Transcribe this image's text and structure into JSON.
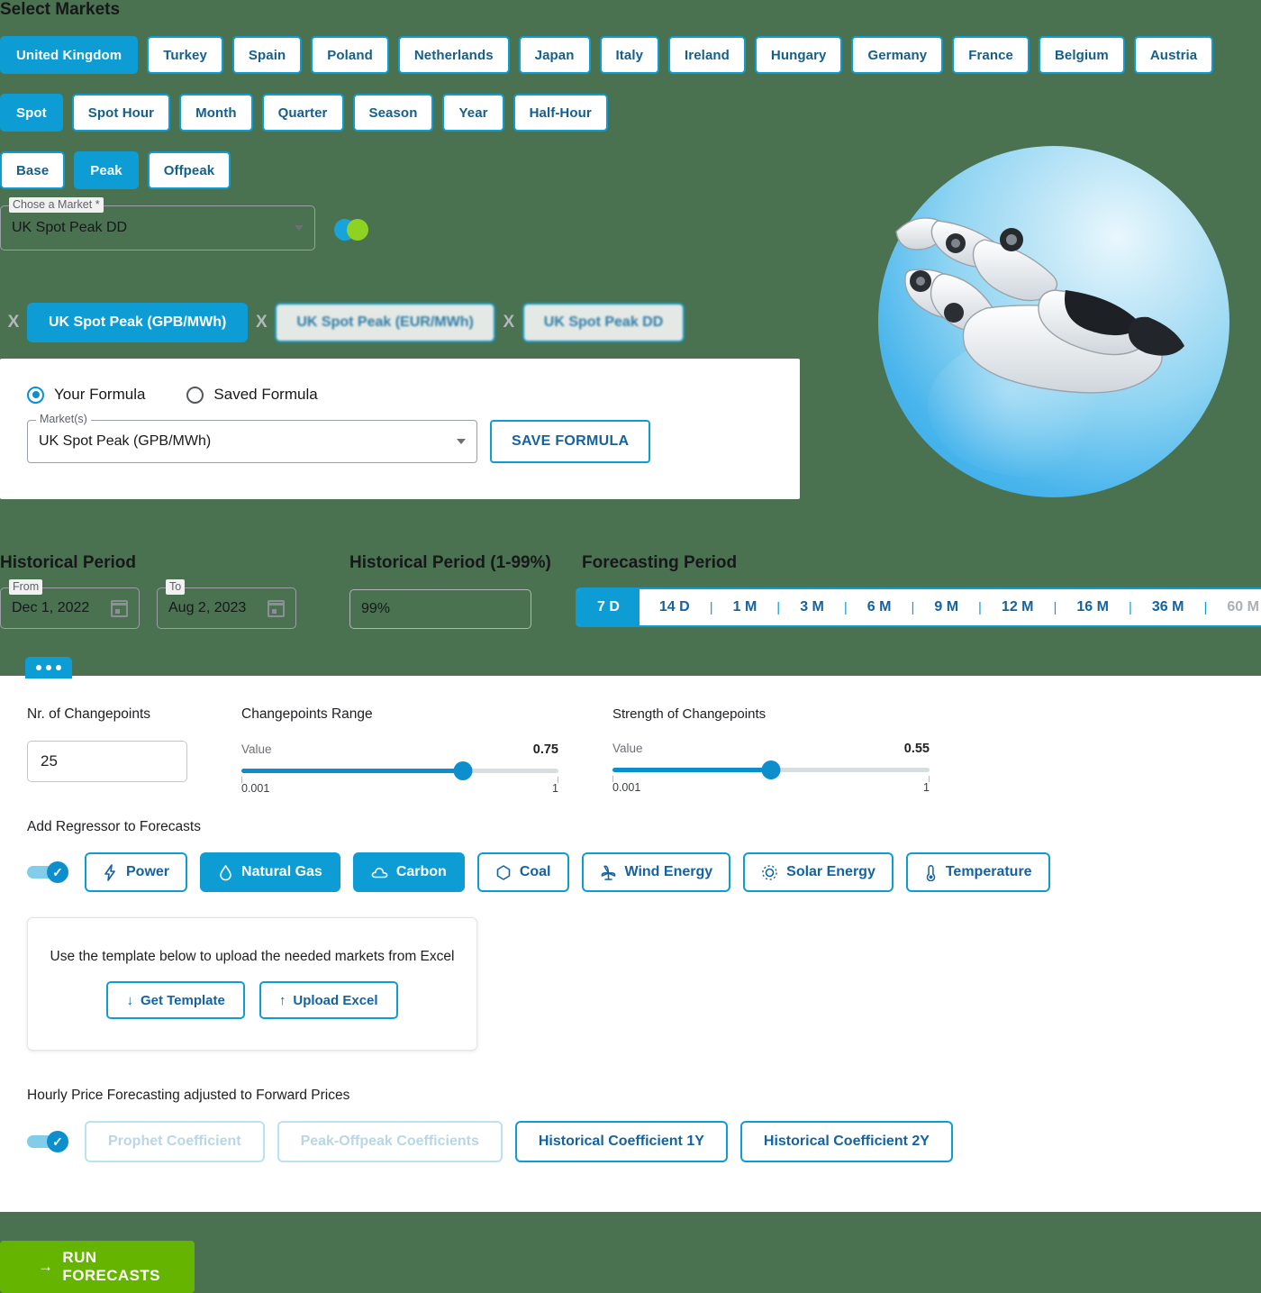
{
  "colors": {
    "accent": "#0d9dd4",
    "accent_dark": "#1463a0",
    "green_bg": "#4a7150",
    "run_green": "#64b400",
    "venn_blue": "#19a3db",
    "venn_green": "#8ed222"
  },
  "markets": {
    "title": "Select Markets",
    "countries": [
      {
        "label": "United Kingdom",
        "active": true
      },
      {
        "label": "Turkey",
        "active": false
      },
      {
        "label": "Spain",
        "active": false
      },
      {
        "label": "Poland",
        "active": false
      },
      {
        "label": "Netherlands",
        "active": false
      },
      {
        "label": "Japan",
        "active": false
      },
      {
        "label": "Italy",
        "active": false
      },
      {
        "label": "Ireland",
        "active": false
      },
      {
        "label": "Hungary",
        "active": false
      },
      {
        "label": "Germany",
        "active": false
      },
      {
        "label": "France",
        "active": false
      },
      {
        "label": "Belgium",
        "active": false
      },
      {
        "label": "Austria",
        "active": false
      }
    ],
    "granularities": [
      {
        "label": "Spot",
        "active": true
      },
      {
        "label": "Spot Hour",
        "active": false
      },
      {
        "label": "Month",
        "active": false
      },
      {
        "label": "Quarter",
        "active": false
      },
      {
        "label": "Season",
        "active": false
      },
      {
        "label": "Year",
        "active": false
      },
      {
        "label": "Half-Hour",
        "active": false
      }
    ],
    "loadshapes": [
      {
        "label": "Base",
        "active": false
      },
      {
        "label": "Peak",
        "active": true
      },
      {
        "label": "Offpeak",
        "active": false
      }
    ],
    "chose_market": {
      "label": "Chose a Market *",
      "value": "UK Spot Peak DD"
    },
    "chips": [
      {
        "label": "UK Spot Peak (GPB/MWh)",
        "active": true,
        "blurred": false,
        "remove": "X"
      },
      {
        "label": "UK Spot Peak (EUR/MWh)",
        "active": false,
        "blurred": true,
        "remove": "X"
      },
      {
        "label": "UK Spot Peak DD",
        "active": false,
        "blurred": true,
        "remove": "X"
      }
    ]
  },
  "formula": {
    "your_formula": "Your Formula",
    "saved_formula": "Saved Formula",
    "markets_label": "Market(s)",
    "markets_value": "UK Spot Peak (GPB/MWh)",
    "save_button": "SAVE FORMULA"
  },
  "periods": {
    "historical_title": "Historical Period",
    "from_label": "From",
    "from_value": "Dec 1, 2022",
    "to_label": "To",
    "to_value": "Aug 2, 2023",
    "percent_title": "Historical Period (1-99%)",
    "percent_value": "99%",
    "forecasting_title": "Forecasting Period",
    "forecast_options": [
      {
        "label": "7 D",
        "active": true,
        "disabled": false
      },
      {
        "label": "14 D",
        "active": false,
        "disabled": false
      },
      {
        "label": "1 M",
        "active": false,
        "disabled": false
      },
      {
        "label": "3 M",
        "active": false,
        "disabled": false
      },
      {
        "label": "6 M",
        "active": false,
        "disabled": false
      },
      {
        "label": "9 M",
        "active": false,
        "disabled": false
      },
      {
        "label": "12 M",
        "active": false,
        "disabled": false
      },
      {
        "label": "16 M",
        "active": false,
        "disabled": false
      },
      {
        "label": "36 M",
        "active": false,
        "disabled": false
      },
      {
        "label": "60 M",
        "active": false,
        "disabled": true
      }
    ],
    "separator": "|"
  },
  "advanced": {
    "changepoints_count_label": "Nr. of Changepoints",
    "changepoints_count_value": "25",
    "changepoints_range": {
      "title": "Changepoints Range",
      "value_label": "Value",
      "value": "0.75",
      "min": "0.001",
      "max": "1",
      "fill_percent": 70
    },
    "changepoints_strength": {
      "title": "Strength of Changepoints",
      "value_label": "Value",
      "value": "0.55",
      "min": "0.001",
      "max": "1",
      "fill_percent": 50
    }
  },
  "regressors": {
    "label": "Add Regressor to Forecasts",
    "toggle_on": true,
    "toggle_check": "✓",
    "items": [
      {
        "label": "Power",
        "icon": "bolt-icon",
        "active": false
      },
      {
        "label": "Natural Gas",
        "icon": "droplet-icon",
        "active": true
      },
      {
        "label": "Carbon",
        "icon": "cloud-icon",
        "active": true
      },
      {
        "label": "Coal",
        "icon": "hexagon-icon",
        "active": false
      },
      {
        "label": "Wind Energy",
        "icon": "wind-turbine-icon",
        "active": false
      },
      {
        "label": "Solar Energy",
        "icon": "sun-icon",
        "active": false
      },
      {
        "label": "Temperature",
        "icon": "thermometer-icon",
        "active": false
      }
    ]
  },
  "upload": {
    "text": "Use the template below to upload the needed markets from Excel",
    "get_template": "Get Template",
    "get_template_arrow": "↓",
    "upload_excel": "Upload Excel",
    "upload_excel_arrow": "↑"
  },
  "hourly": {
    "label": "Hourly Price Forecasting adjusted to Forward Prices",
    "toggle_on": true,
    "toggle_check": "✓",
    "items": [
      {
        "label": "Prophet Coefficient",
        "disabled": true
      },
      {
        "label": "Peak-Offpeak Coefficients",
        "disabled": true
      },
      {
        "label": "Historical Coefficient 1Y",
        "disabled": false
      },
      {
        "label": "Historical Coefficient 2Y",
        "disabled": false
      }
    ]
  },
  "run": {
    "label": "RUN FORECASTS",
    "arrow": "→"
  },
  "image": {
    "alt": "robot-hand-sphere"
  }
}
